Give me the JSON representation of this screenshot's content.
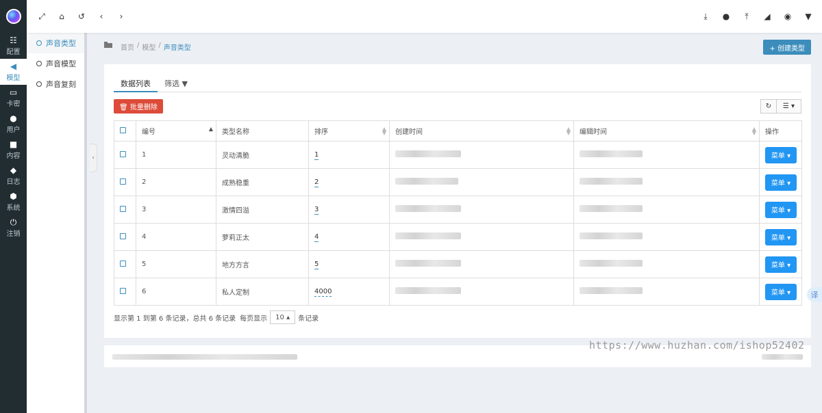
{
  "rail": {
    "items": [
      {
        "label": "配置",
        "icon": "sliders-icon",
        "glyph": "☷"
      },
      {
        "label": "模型",
        "icon": "volume-icon",
        "glyph": "◀"
      },
      {
        "label": "卡密",
        "icon": "card-icon",
        "glyph": "▭"
      },
      {
        "label": "用户",
        "icon": "users-icon",
        "glyph": "●"
      },
      {
        "label": "内容",
        "icon": "book-icon",
        "glyph": "■"
      },
      {
        "label": "日志",
        "icon": "shield-icon",
        "glyph": "◆"
      },
      {
        "label": "系统",
        "icon": "cube-icon",
        "glyph": "⬢"
      },
      {
        "label": "注销",
        "icon": "power-icon",
        "glyph": "⏻"
      }
    ],
    "active_index": 1
  },
  "submenu": {
    "items": [
      "声音类型",
      "声音模型",
      "声音复刻"
    ],
    "active_index": 0
  },
  "breadcrumb": {
    "home": "首页",
    "sep": "/",
    "level2": "模型",
    "current": "声音类型"
  },
  "create_button": "+ 创建类型",
  "tabs": [
    "数据列表",
    "筛选 ▼"
  ],
  "batch_delete": "🗑 批量删除",
  "table": {
    "headers": [
      "编号",
      "类型名称",
      "排序",
      "创建时间",
      "编辑时间",
      "操作"
    ],
    "rows": [
      {
        "id": "1",
        "name": "灵动清脆",
        "sort": "1",
        "action": "菜单 ▾"
      },
      {
        "id": "2",
        "name": "成熟稳重",
        "sort": "2",
        "action": "菜单 ▾"
      },
      {
        "id": "3",
        "name": "激情四溢",
        "sort": "3",
        "action": "菜单 ▾"
      },
      {
        "id": "4",
        "name": "萝莉正太",
        "sort": "4",
        "action": "菜单 ▾"
      },
      {
        "id": "5",
        "name": "地方方言",
        "sort": "5",
        "action": "菜单 ▾"
      },
      {
        "id": "6",
        "name": "私人定制",
        "sort": "4000",
        "action": "菜单 ▾"
      }
    ]
  },
  "pager": {
    "summary": "显示第 1 到第 6 条记录，总共 6 条记录",
    "per_page_prefix": "每页显示",
    "per_page_value": "10 ▴",
    "per_page_suffix": "条记录"
  },
  "watermark": "https://www.huzhan.com/ishop52402",
  "float_translate": "译",
  "colors": {
    "primary": "#3c8dbc",
    "danger": "#dd4b39",
    "menu_button": "#2196f3",
    "rail_bg": "#222d32"
  }
}
